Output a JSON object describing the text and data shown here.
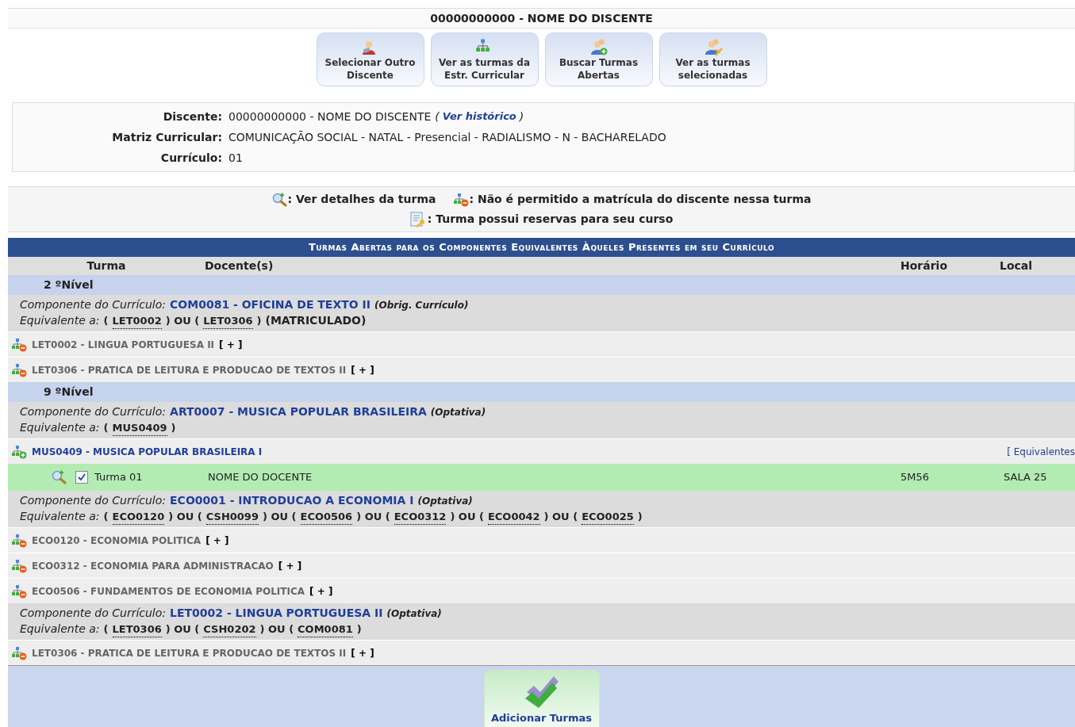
{
  "student_header": {
    "title": "00000000000 - NOME DO DISCENTE"
  },
  "actions": [
    {
      "kind": "person",
      "label": "Selecionar Outro Discente"
    },
    {
      "kind": "tree",
      "label": "Ver as turmas da Estr. Curricular"
    },
    {
      "kind": "people-add",
      "label": "Buscar Turmas Abertas"
    },
    {
      "kind": "people-edit",
      "label": "Ver as turmas selecionadas"
    }
  ],
  "student_info": [
    {
      "label": "Discente:",
      "value": "00000000000 - NOME DO DISCENTE",
      "link": {
        "before": "(",
        "text": "Ver histórico",
        "after": ")"
      }
    },
    {
      "label": "Matriz Curricular:",
      "value": "COMUNICAÇÃO SOCIAL - NATAL - Presencial - RADIALISMO - N - BACHARELADO"
    },
    {
      "label": "Currículo:",
      "value": "01"
    }
  ],
  "legend_lines": [
    [
      {
        "kind": "details",
        "text": ": Ver detalhes da turma"
      },
      {
        "kind": "blocked",
        "text": ": Não é permitido a matrícula do discente nessa turma"
      }
    ],
    [
      {
        "kind": "reserved",
        "text": ": Turma possui reservas para seu curso"
      }
    ]
  ],
  "table": {
    "title": "Turmas Abertas para os Componentes Equivalentes Àqueles Presentes em seu Currículo",
    "columns": [
      "Turma",
      "Docente(s)",
      "Horário",
      "Local"
    ],
    "levels": [
      {
        "label": "2 ºNível",
        "components": [
          {
            "label": "Componente do Currículo:",
            "name": "COM0081 - OFICINA DE TEXTO II",
            "type": "(Obrig. Currículo)",
            "equivalence_label": "Equivalente a:",
            "equivalence": [
              "(",
              "LET0002",
              ") OU (",
              "LET0306",
              ")"
            ],
            "status": "(MATRICULADO)",
            "disciplines": [
              {
                "kind": "blocked",
                "name": "LET0002 - LINGUA PORTUGUESA II",
                "expand": "[ + ]"
              },
              {
                "kind": "blocked",
                "name": "LET0306 - PRATICA DE LEITURA E PRODUCAO DE TEXTOS II",
                "expand": "[ + ]"
              }
            ]
          }
        ]
      },
      {
        "label": "9 ºNível",
        "components": [
          {
            "label": "Componente do Currículo:",
            "name": "ART0007 - MUSICA POPULAR BRASILEIRA",
            "type": "(Optativa)",
            "equivalence_label": "Equivalente a:",
            "equivalence": [
              "(",
              "MUS0409",
              ")"
            ],
            "disciplines": [
              {
                "kind": "open",
                "name": "MUS0409 - MUSICA POPULAR BRASILEIRA I",
                "equivalents_link": "[ Equivalentes",
                "classes": [
                  {
                    "turma": "Turma 01",
                    "docente": "NOME DO DOCENTE",
                    "horario": "5M56",
                    "local": "SALA 25",
                    "checked": true
                  }
                ]
              }
            ]
          },
          {
            "label": "Componente do Currículo:",
            "name": "ECO0001 - INTRODUCAO A ECONOMIA I",
            "type": "(Optativa)",
            "equivalence_label": "Equivalente a:",
            "equivalence": [
              "(",
              "ECO0120",
              ") OU (",
              "CSH0099",
              ") OU (",
              "ECO0506",
              ") OU (",
              "ECO0312",
              ") OU (",
              "ECO0042",
              ") OU (",
              "ECO0025",
              ")"
            ],
            "disciplines": [
              {
                "kind": "blocked",
                "name": "ECO0120 - ECONOMIA POLITICA",
                "expand": "[ + ]"
              },
              {
                "kind": "blocked",
                "name": "ECO0312 - ECONOMIA PARA ADMINISTRACAO",
                "expand": "[ + ]"
              },
              {
                "kind": "blocked",
                "name": "ECO0506 - FUNDAMENTOS DE ECONOMIA POLITICA",
                "expand": "[ + ]"
              }
            ]
          },
          {
            "label": "Componente do Currículo:",
            "name": "LET0002 - LINGUA PORTUGUESA II",
            "type": "(Optativa)",
            "equivalence_label": "Equivalente a:",
            "equivalence": [
              "(",
              "LET0306",
              ") OU (",
              "CSH0202",
              ") OU (",
              "COM0081",
              ")"
            ],
            "disciplines": [
              {
                "kind": "blocked",
                "name": "LET0306 - PRATICA DE LEITURA E PRODUCAO DE TEXTOS II",
                "expand": "[ + ]"
              }
            ]
          }
        ]
      }
    ]
  },
  "submit": {
    "label": "Adicionar Turmas"
  }
}
